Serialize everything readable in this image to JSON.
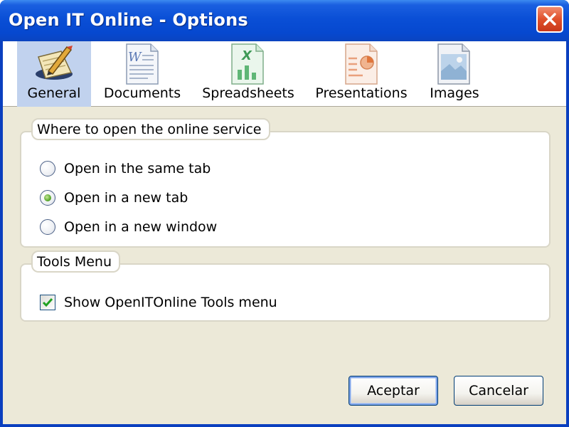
{
  "window": {
    "title": "Open IT Online - Options"
  },
  "tabs": [
    {
      "label": "General",
      "icon": "pen-paper-icon",
      "active": true
    },
    {
      "label": "Documents",
      "icon": "word-document-icon",
      "active": false
    },
    {
      "label": "Spreadsheets",
      "icon": "excel-spreadsheet-icon",
      "active": false
    },
    {
      "label": "Presentations",
      "icon": "powerpoint-presentation-icon",
      "active": false
    },
    {
      "label": "Images",
      "icon": "image-file-icon",
      "active": false
    }
  ],
  "open_group": {
    "title": "Where to open the online service",
    "options": [
      {
        "label": "Open in the same tab",
        "checked": false
      },
      {
        "label": "Open in a new tab",
        "checked": true
      },
      {
        "label": "Open in a new window",
        "checked": false
      }
    ]
  },
  "tools_group": {
    "title": "Tools Menu",
    "checkbox_label": "Show OpenITOnline Tools menu",
    "checkbox_checked": true
  },
  "buttons": {
    "ok": "Aceptar",
    "cancel": "Cancelar"
  },
  "colors": {
    "titlebar": "#0a4fd6",
    "client": "#ece9d8",
    "active_tab": "#c1d2ee",
    "close": "#e0502b"
  }
}
